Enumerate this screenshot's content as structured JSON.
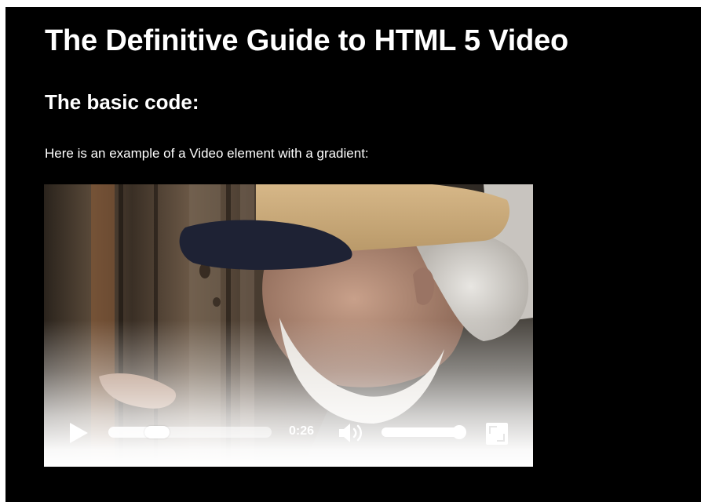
{
  "page": {
    "title": "The Definitive Guide to HTML 5 Video",
    "section_heading": "The basic code:",
    "intro_text": "Here is an example of a Video element with a gradient:"
  },
  "video": {
    "current_time": "0:26",
    "progress_fraction": 0.3,
    "volume_fraction": 0.92,
    "icons": {
      "play": "play-icon",
      "volume": "volume-icon",
      "fullscreen": "fullscreen-icon"
    }
  },
  "colors": {
    "page_background": "#000000",
    "text": "#ffffff",
    "controls": "#ffffff"
  }
}
